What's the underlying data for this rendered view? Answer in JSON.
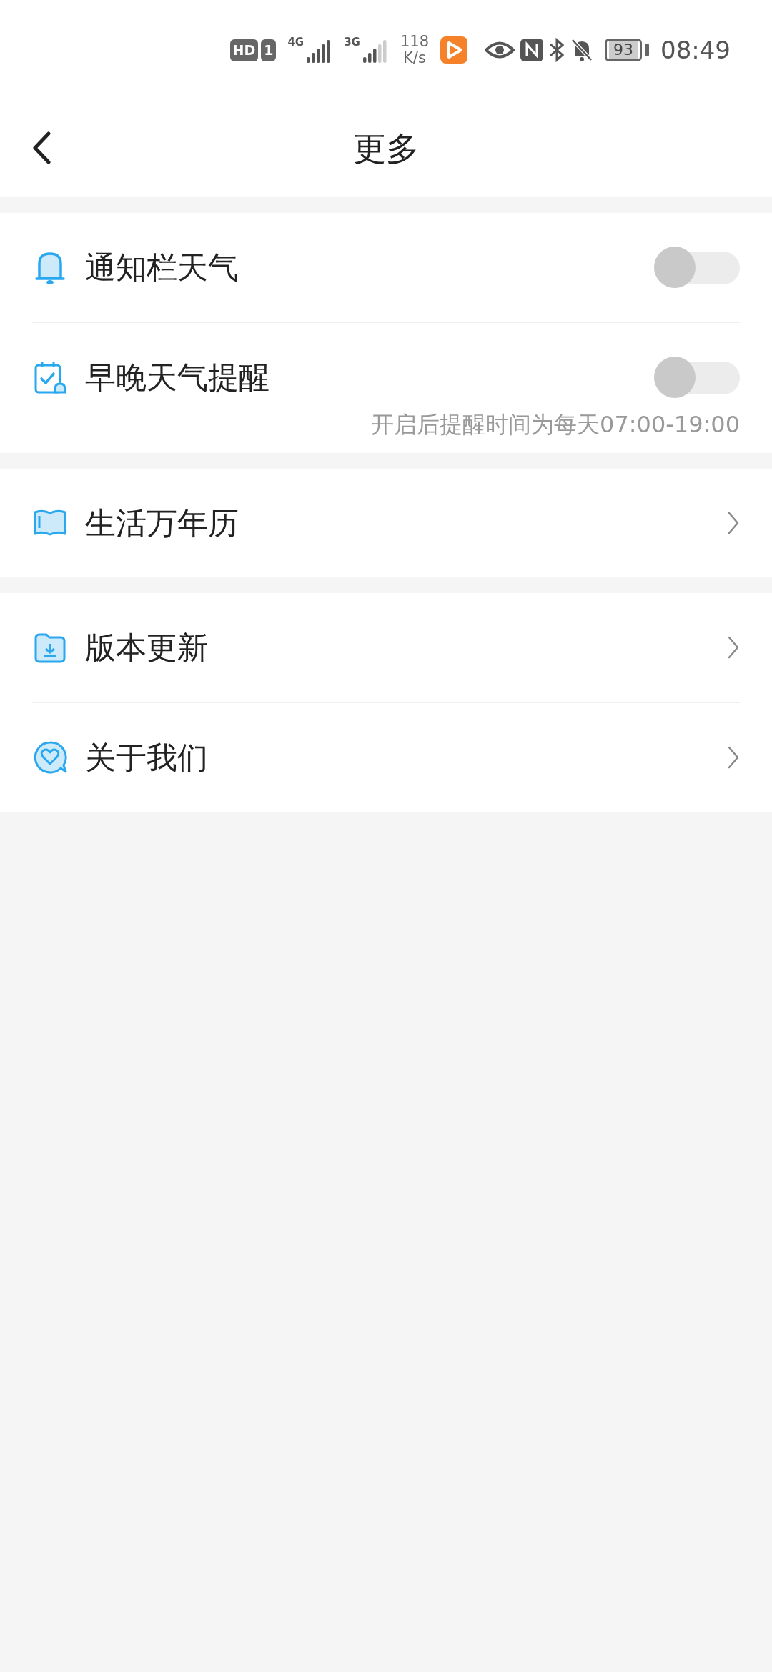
{
  "status_bar": {
    "hd": "HD",
    "sim": "1",
    "networks": [
      "4G",
      "3G"
    ],
    "speed": "118",
    "speed_unit": "K/s",
    "battery": "93",
    "time": "08:49"
  },
  "header": {
    "title": "更多"
  },
  "groups": [
    {
      "items": [
        {
          "kind": "toggle",
          "label": "通知栏天气",
          "on": false
        },
        {
          "kind": "toggle",
          "label": "早晚天气提醒",
          "on": false,
          "hint": "开启后提醒时间为每天07:00-19:00"
        }
      ]
    },
    {
      "items": [
        {
          "kind": "link",
          "label": "生活万年历"
        }
      ]
    },
    {
      "items": [
        {
          "kind": "link",
          "label": "版本更新"
        },
        {
          "kind": "link",
          "label": "关于我们"
        }
      ]
    }
  ]
}
